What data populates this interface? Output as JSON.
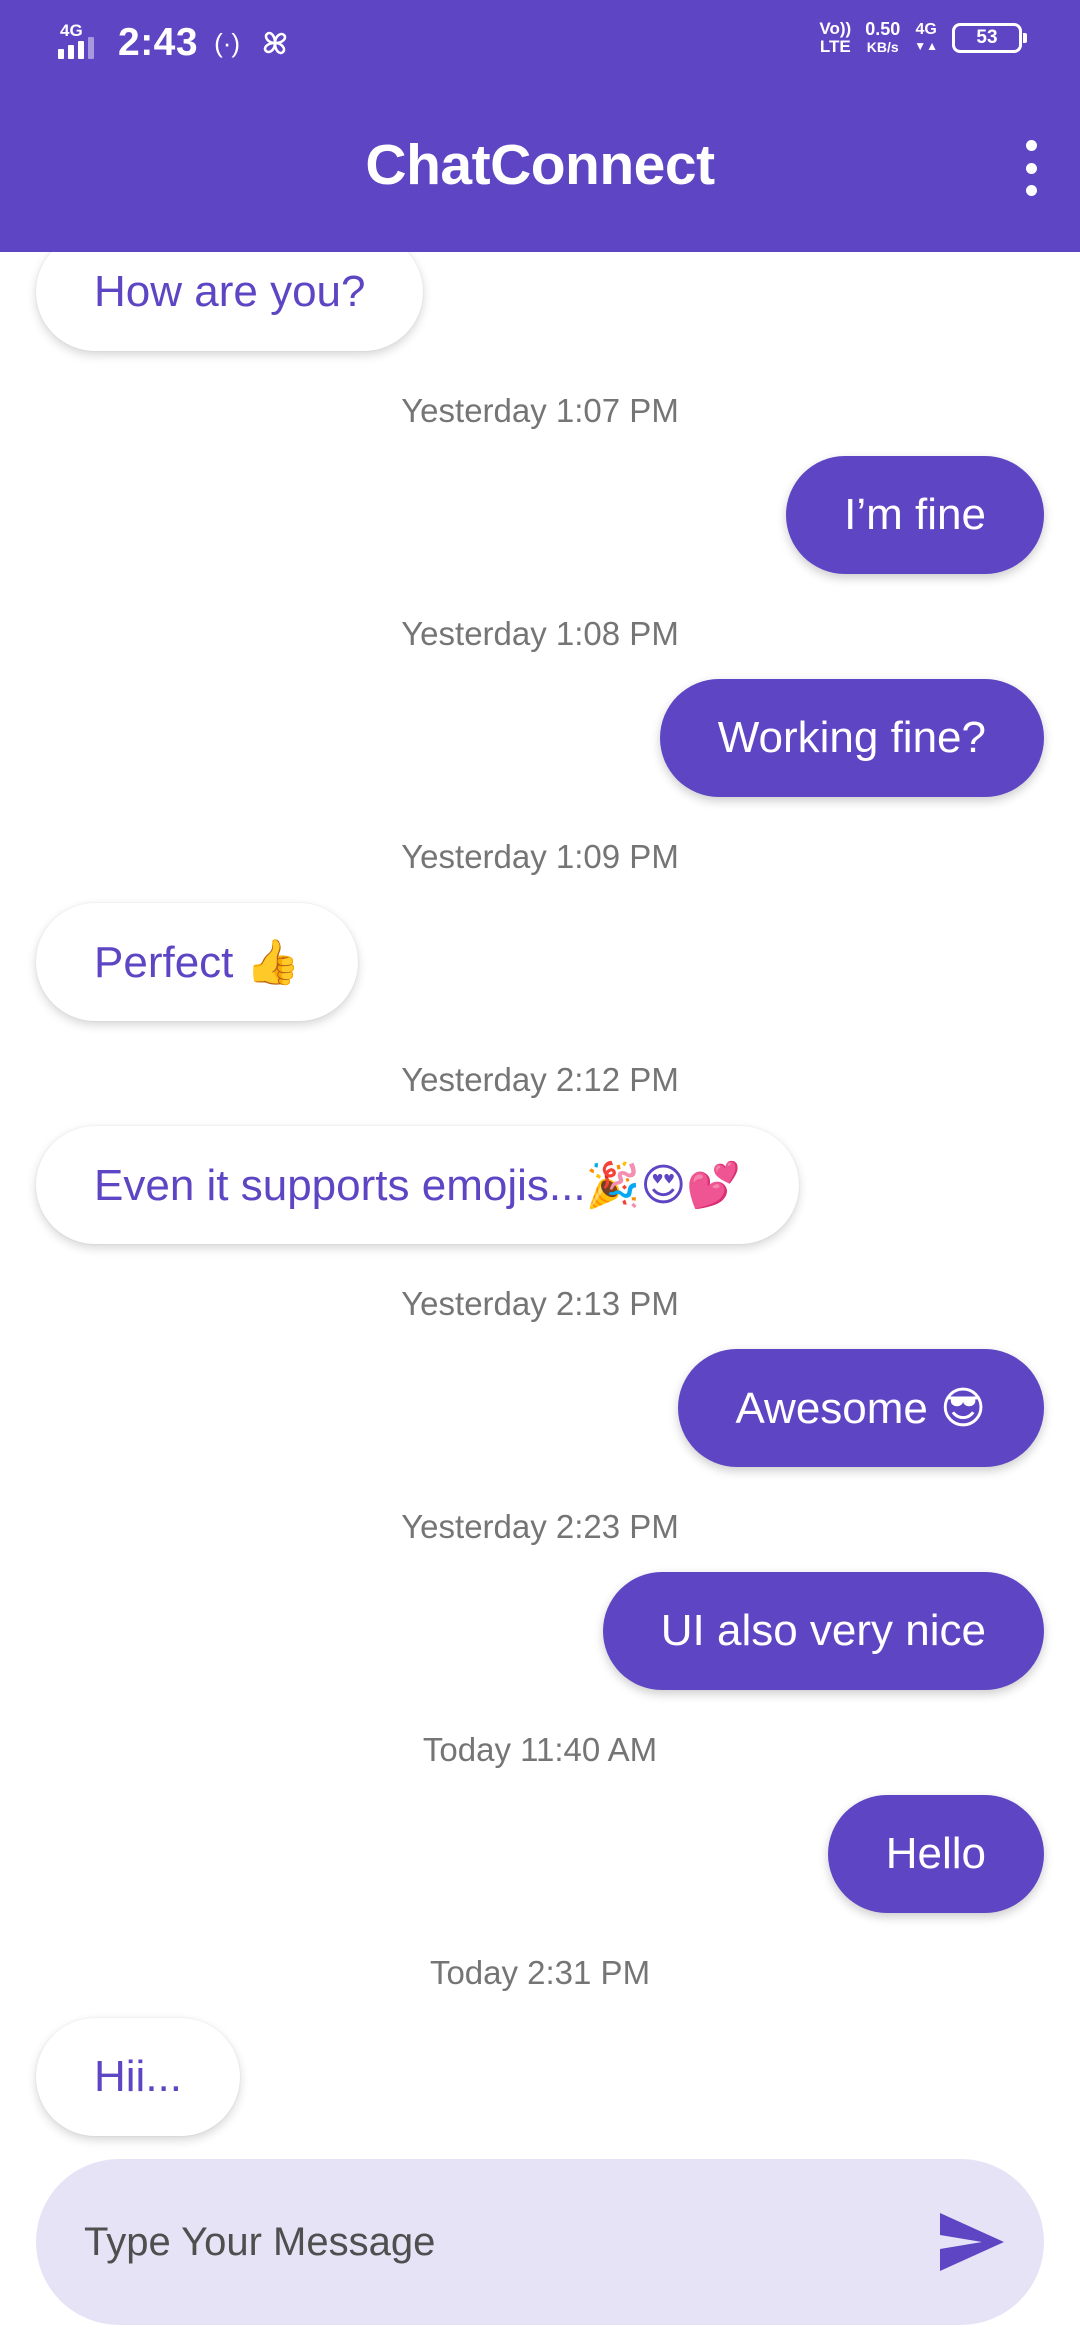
{
  "status_bar": {
    "network_label": "4G",
    "time": "2:43",
    "hotspot_icon": "(·)",
    "volte": "Vo))",
    "lte": "LTE",
    "speed_value": "0.50",
    "speed_unit": "KB/s",
    "net_type": "4G",
    "battery": "53"
  },
  "app_bar": {
    "title": "ChatConnect",
    "menu_icon": "more-vert-icon"
  },
  "messages": [
    {
      "direction": "incoming",
      "text": "How are you?"
    },
    {
      "timestamp": "Yesterday 1:07 PM"
    },
    {
      "direction": "outgoing",
      "text": "I’m fine"
    },
    {
      "timestamp": "Yesterday 1:08 PM"
    },
    {
      "direction": "outgoing",
      "text": "Working fine?"
    },
    {
      "timestamp": "Yesterday 1:09 PM"
    },
    {
      "direction": "incoming",
      "text": "Perfect 👍"
    },
    {
      "timestamp": "Yesterday 2:12 PM"
    },
    {
      "direction": "incoming",
      "text": "Even it supports emojis...🎉😍💕"
    },
    {
      "timestamp": "Yesterday 2:13 PM"
    },
    {
      "direction": "outgoing",
      "text": "Awesome 😎"
    },
    {
      "timestamp": "Yesterday 2:23 PM"
    },
    {
      "direction": "outgoing",
      "text": "UI also very nice"
    },
    {
      "timestamp": "Today 11:40 AM"
    },
    {
      "direction": "outgoing",
      "text": "Hello"
    },
    {
      "timestamp": "Today 2:31 PM"
    },
    {
      "direction": "incoming",
      "text": "Hii..."
    }
  ],
  "composer": {
    "placeholder": "Type Your Message",
    "value": "",
    "send_icon": "send-icon"
  },
  "colors": {
    "primary": "#5e45c4",
    "input_background": "#e6e3f6",
    "timestamp_text": "#757575"
  }
}
